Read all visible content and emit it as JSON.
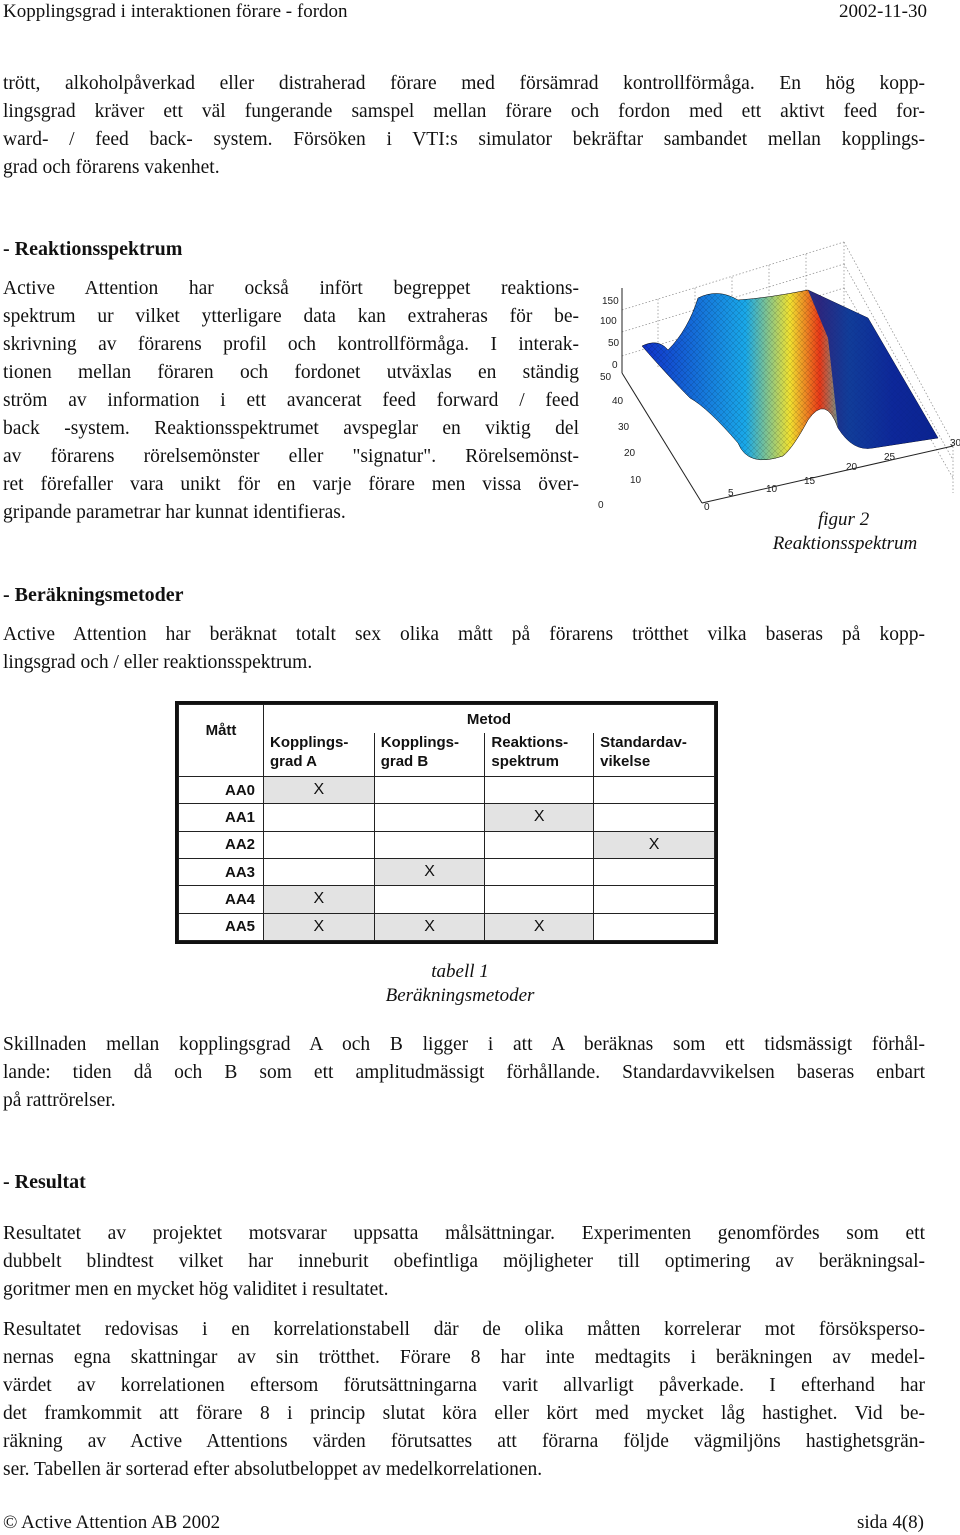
{
  "header": {
    "title": "Kopplingsgrad i interaktionen förare - fordon",
    "date": "2002-11-30"
  },
  "intro_paragraph": [
    "trött, alkoholpåverkad eller distraherad förare med försämrad kontrollförmåga. En hög kopp-",
    "lingsgrad kräver ett väl fungerande samspel mellan förare och fordon med ett aktivt feed for-",
    "ward- / feed back- system. Försöken i VTI:s simulator bekräftar sambandet mellan kopplings-",
    "grad och förarens vakenhet."
  ],
  "section_reaktion": {
    "heading": "- Reaktionsspektrum",
    "paragraph": [
      "Active Attention har också infört begreppet reaktions-",
      "spektrum ur vilket ytterligare data kan extraheras för be-",
      "skrivning av förarens profil och kontrollförmåga. I interak-",
      "tionen mellan föraren och fordonet utväxlas en ständig",
      "ström av information i ett avancerat feed forward / feed",
      "back -system. Reaktionsspektrumet avspeglar en viktig del",
      "av förarens rörelsemönster eller \"signatur\". Rörelsemönst-",
      "ret förefaller vara unikt för en varje förare men vissa över-",
      "gripande parametrar har kunnat identifieras."
    ],
    "figure": {
      "caption_line1": "figur 2",
      "caption_line2": "Reaktionsspektrum",
      "z_ticks": [
        "150",
        "100",
        "50",
        "0"
      ],
      "y_ticks": [
        "50",
        "40",
        "30",
        "20",
        "10",
        "0"
      ],
      "x_ticks": [
        "0",
        "5",
        "10",
        "15",
        "20",
        "25",
        "30"
      ]
    }
  },
  "section_berakning": {
    "heading": "- Beräkningsmetoder",
    "paragraph": [
      "Active Attention har beräknat totalt sex olika mått på förarens trötthet vilka baseras på kopp-",
      "lingsgrad och / eller reaktionsspektrum."
    ],
    "table": {
      "corner_header": "Mått",
      "group_header": "Metod",
      "columns": [
        "Kopplings-\ngrad A",
        "Kopplings-\ngrad B",
        "Reaktions-\nspektrum",
        "Standardav-\nvikelse"
      ],
      "rows": [
        {
          "label": "AA0",
          "cells": [
            "X",
            "",
            "",
            ""
          ]
        },
        {
          "label": "AA1",
          "cells": [
            "",
            "",
            "X",
            ""
          ]
        },
        {
          "label": "AA2",
          "cells": [
            "",
            "",
            "",
            "X"
          ]
        },
        {
          "label": "AA3",
          "cells": [
            "",
            "X",
            "",
            ""
          ]
        },
        {
          "label": "AA4",
          "cells": [
            "X",
            "",
            "",
            ""
          ]
        },
        {
          "label": "AA5",
          "cells": [
            "X",
            "X",
            "X",
            ""
          ]
        }
      ],
      "caption_line1": "tabell 1",
      "caption_line2": "Beräkningsmetoder"
    },
    "after_table_paragraph": [
      "Skillnaden mellan kopplingsgrad A och B ligger i att A beräknas som ett tidsmässigt förhål-",
      "lande: tiden då och B som ett amplitudmässigt förhållande. Standardavvikelsen baseras enbart",
      "på rattrörelser."
    ]
  },
  "section_resultat": {
    "heading": "- Resultat",
    "paragraph1": [
      "Resultatet av projektet motsvarar uppsatta målsättningar. Experimenten genomfördes som ett",
      "dubbelt blindtest vilket har inneburit obefintliga möjligheter till optimering av beräkningsal-",
      "goritmer men en mycket hög validitet i resultatet."
    ],
    "paragraph2": [
      "Resultatet redovisas i en korrelationstabell där de olika måtten korrelerar mot försöksperso-",
      "nernas egna skattningar av sin trötthet. Förare 8 har inte medtagits i beräkningen av medel-",
      "värdet av korrelationen eftersom förutsättningarna varit allvarligt påverkade. I efterhand har",
      "det framkommit att förare 8 i princip slutat köra eller kört med mycket låg hastighet. Vid be-",
      "räkning av Active Attentions värden förutsattes att förarna följde vägmiljöns hastighetsgrän-",
      "ser. Tabellen är sorterad efter absolutbeloppet av medelkorrelationen."
    ]
  },
  "footer": {
    "copyright": "© Active Attention AB 2002",
    "page": "sida 4(8)"
  }
}
